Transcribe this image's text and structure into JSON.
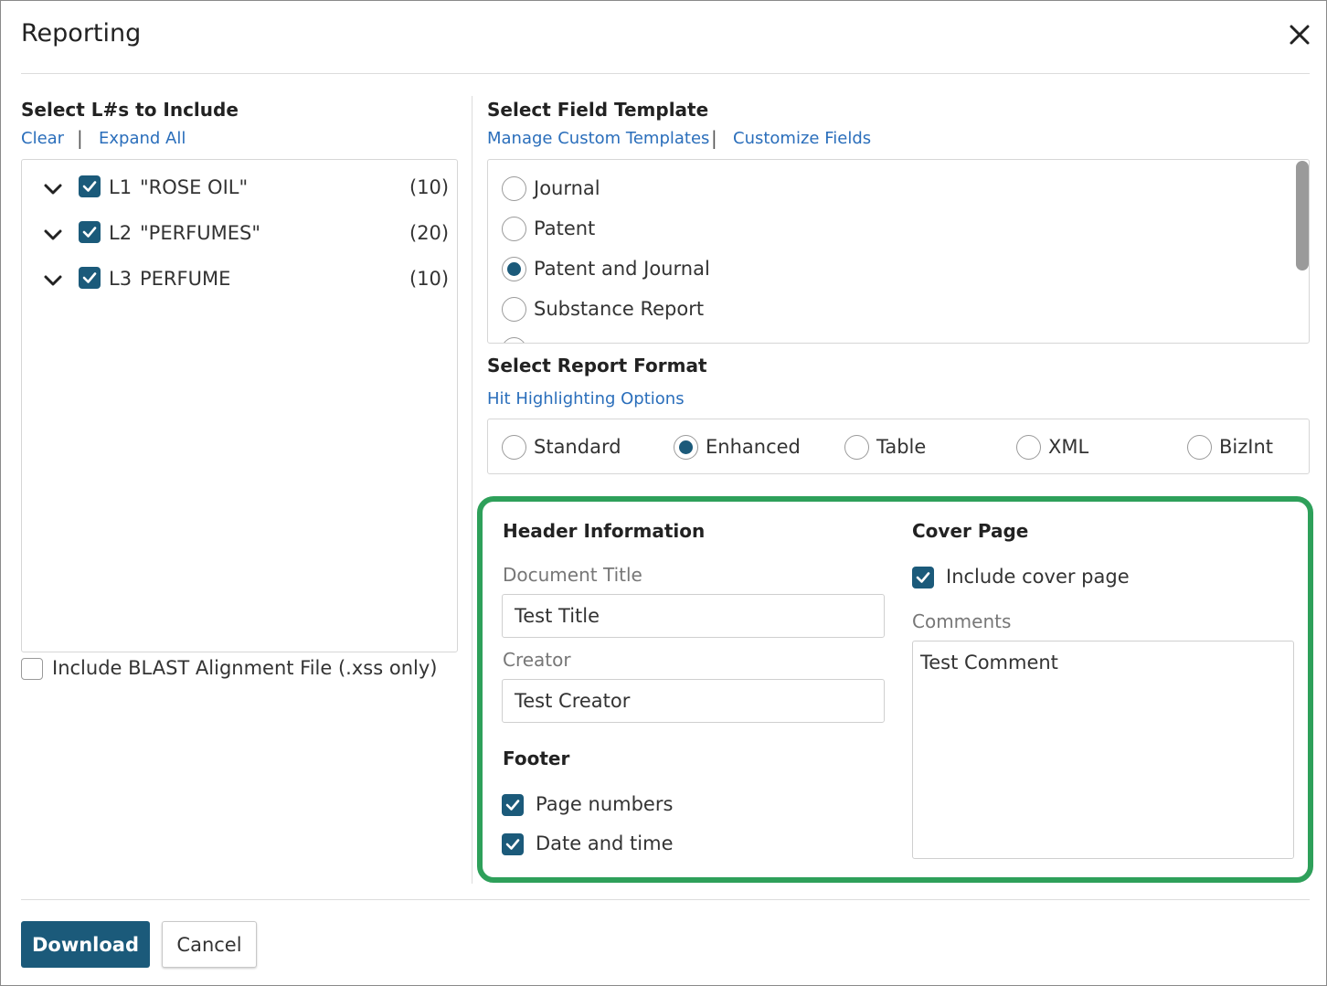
{
  "dialog": {
    "title": "Reporting"
  },
  "left": {
    "heading": "Select L#s to Include",
    "links": {
      "clear": "Clear",
      "separator": "|",
      "expand_all": "Expand All"
    },
    "items": [
      {
        "id": "L1",
        "name": "\"ROSE OIL\"",
        "count": "(10)",
        "checked": true
      },
      {
        "id": "L2",
        "name": "\"PERFUMES\"",
        "count": "(20)",
        "checked": true
      },
      {
        "id": "L3",
        "name": "PERFUME",
        "count": "(10)",
        "checked": true
      }
    ],
    "blast_label": "Include BLAST Alignment File (.xss only)"
  },
  "template": {
    "heading": "Select Field Template",
    "links": {
      "manage": "Manage Custom Templates",
      "separator": "|",
      "customize": "Customize Fields"
    },
    "options": [
      {
        "label": "Journal",
        "selected": false
      },
      {
        "label": "Patent",
        "selected": false
      },
      {
        "label": "Patent and Journal",
        "selected": true
      },
      {
        "label": "Substance Report",
        "selected": false
      }
    ]
  },
  "format": {
    "heading": "Select Report Format",
    "link": "Hit Highlighting Options",
    "options": [
      {
        "label": "Standard",
        "selected": false
      },
      {
        "label": "Enhanced",
        "selected": true
      },
      {
        "label": "Table",
        "selected": false
      },
      {
        "label": "XML",
        "selected": false
      },
      {
        "label": "BizInt",
        "selected": false
      }
    ]
  },
  "header_info": {
    "heading": "Header Information",
    "doc_title_label": "Document Title",
    "doc_title_value": "Test Title",
    "creator_label": "Creator",
    "creator_value": "Test Creator"
  },
  "footer": {
    "heading": "Footer",
    "page_numbers": "Page numbers",
    "date_time": "Date and time"
  },
  "cover": {
    "heading": "Cover Page",
    "include_label": "Include cover page",
    "comments_label": "Comments",
    "comments_value": "Test Comment"
  },
  "buttons": {
    "download": "Download",
    "cancel": "Cancel"
  },
  "colors": {
    "accent": "#1b5a7a",
    "link": "#2a6ebb",
    "highlight": "#2ea05a"
  }
}
